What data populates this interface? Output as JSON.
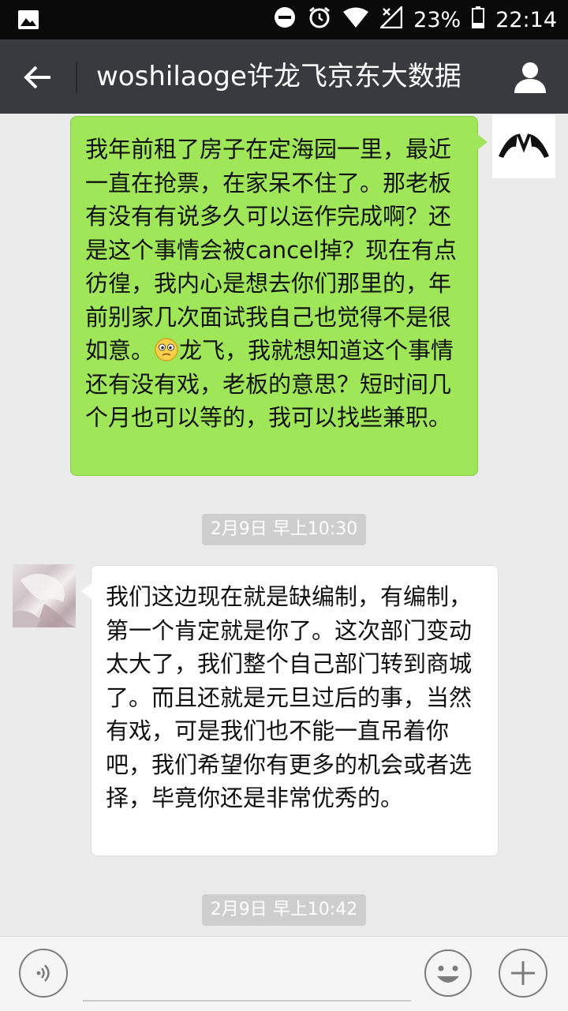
{
  "status_bar": {
    "battery_percent": "23%",
    "time": "22:14",
    "icons": [
      "image-icon",
      "do-not-disturb-icon",
      "alarm-icon",
      "wifi-icon",
      "no-signal-icon",
      "battery-icon"
    ]
  },
  "header": {
    "title": "woshilaoge许龙飞京东大数据",
    "back_icon": "arrow-left-icon",
    "profile_icon": "person-icon"
  },
  "messages": [
    {
      "sender": "me",
      "text_part1": "我年前租了房子在定海园一里，最近一直在抢票，在家呆不住了。那老板有没有有说多久可以运作完成啊？还是这个事情会被cancel掉？现在有点彷徨，我内心是想去你们那里的，年前别家几次面试我自己也觉得不是很如意。",
      "emoji": "confused-emoji",
      "text_part2": "龙飞，我就想知道这个事情还有没有戏，老板的意思？短时间几个月也可以等的，我可以找些兼职。"
    },
    {
      "type": "timestamp",
      "text": "2月9日 早上10:30"
    },
    {
      "sender": "other",
      "text": "我们这边现在就是缺编制，有编制，第一个肯定就是你了。这次部门变动太大了，我们整个自己部门转到商城了。而且还就是元旦过后的事，当然有戏，可是我们也不能一直吊着你吧，我们希望你有更多的机会或者选择，毕竟你还是非常优秀的。"
    },
    {
      "type": "timestamp",
      "text": "2月9日 早上10:42"
    }
  ],
  "colors": {
    "outgoing_bubble": "#9fe658",
    "incoming_bubble": "#ffffff",
    "chat_background": "#ebebeb",
    "header_background": "#393a3f",
    "timestamp_background": "#cecece"
  },
  "input_bar": {
    "voice_icon": "voice-icon",
    "emoji_icon": "smiley-icon",
    "plus_icon": "plus-icon",
    "value": ""
  }
}
